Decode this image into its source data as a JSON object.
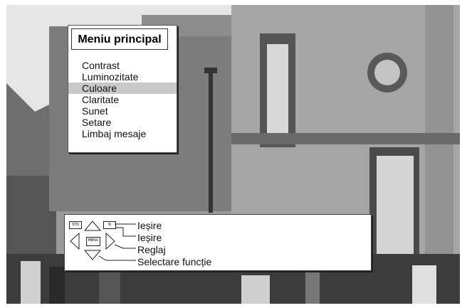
{
  "menu": {
    "title": "Meniu principal",
    "items": [
      {
        "label": "Contrast",
        "selected": false
      },
      {
        "label": "Luminozitate",
        "selected": false
      },
      {
        "label": "Culoare",
        "selected": true
      },
      {
        "label": "Claritate",
        "selected": false
      },
      {
        "label": "Sunet",
        "selected": false
      },
      {
        "label": "Setare",
        "selected": false
      },
      {
        "label": "Limbaj mesaje",
        "selected": false
      }
    ]
  },
  "help": {
    "items": [
      "Ieșire",
      "Ieșire",
      "Reglaj",
      "Selectare funcție"
    ],
    "keys": {
      "left": "STD",
      "right": "N",
      "center": "MENU"
    }
  },
  "icons": [
    "arrow-up-icon",
    "arrow-down-icon",
    "arrow-left-icon",
    "arrow-right-icon"
  ]
}
